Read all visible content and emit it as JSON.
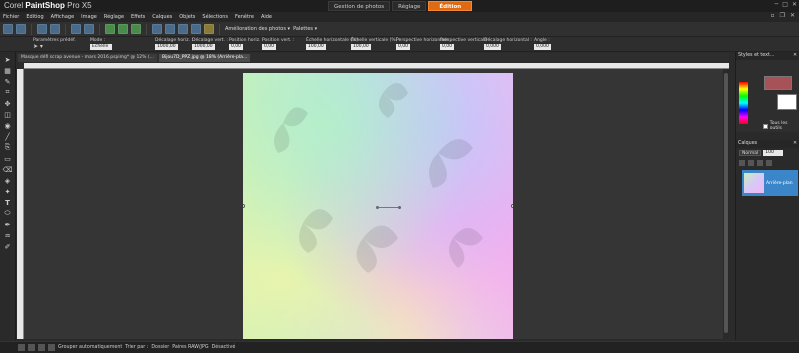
{
  "app": {
    "logo_corel": "Corel",
    "logo_psp": "PaintShop",
    "logo_ver": "Pro X5"
  },
  "workspace_tabs": [
    "Gestion de photos",
    "Réglage",
    "Édition"
  ],
  "menu": [
    "Fichier",
    "Editiog",
    "Affichage",
    "Image",
    "Réglage",
    "Effets",
    "Calques",
    "Objets",
    "Sélections",
    "Fenêtre",
    "Aide"
  ],
  "toolbar": {
    "enhance_photo_label": "Amélioration des photos",
    "palettes_label": "Palettes"
  },
  "options": {
    "preset_label": "Paramètres prédéf.",
    "mode_label": "Mode :",
    "mode_value": "Échelle",
    "pos_h_label": "Décalage horiz. :",
    "pos_h_value": "1000,00",
    "pos_v_label": "Décalage vert. :",
    "pos_v_value": "1000,00",
    "pos_x_label": "Position horiz. :",
    "pos_x_value": "0,00",
    "pos_y_label": "Position vert. :",
    "pos_y_value": "0,00",
    "scale_h_label": "Échelle horizontale (%) :",
    "scale_h_value": "100,00",
    "scale_v_label": "Échelle verticale (%) :",
    "scale_v_value": "100,00",
    "persp_h_label": "Perspective horizontale :",
    "persp_h_value": "0,00",
    "persp_v_label": "Perspective verticale :",
    "persp_v_value": "0,00",
    "shear_label": "Décalage horizontal :",
    "shear_value": "0,000",
    "angle_label": "Angle :",
    "angle_value": "0,000"
  },
  "doc_tabs": [
    "Masque défi scrap avenue - mars 2016.pspimg* @ 12% (...",
    "Bijou7D_PPZ.jpg @ 18% (Arrière-pla..."
  ],
  "styles_panel": {
    "title": "Styles et text...",
    "all_tools": "Tous les outils",
    "fg_color": "#a65257",
    "bg_color": "#ffffff"
  },
  "layers_panel": {
    "title": "Calques",
    "blend_mode": "Normal",
    "opacity": "100",
    "layer_name": "Arrière-plan"
  },
  "statusbar": {
    "group_label": "Grouper automatiquement",
    "sort_label": "Trier par :",
    "sort_value": "Dossier",
    "raw_label": "Paires RAW/JPG",
    "raw_value": "Désactivé"
  },
  "colors": {
    "accent": "#e06a12",
    "layer_selected": "#3a86c8"
  }
}
